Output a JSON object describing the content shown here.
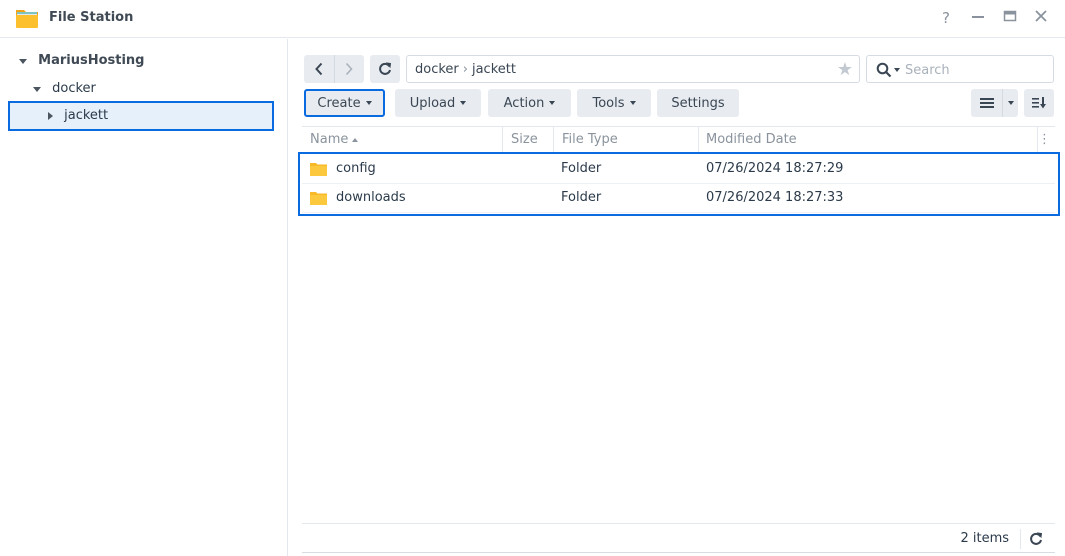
{
  "window": {
    "title": "File Station",
    "controls": {
      "help": "?",
      "minimize": "—",
      "maximize": "▭",
      "close": "✕"
    }
  },
  "tree": {
    "root": "MariusHosting",
    "children": [
      {
        "label": "docker",
        "expanded": true
      },
      {
        "label": "jackett",
        "expanded": false,
        "selected": true
      }
    ]
  },
  "navigation": {
    "path": [
      "docker",
      "jackett"
    ],
    "path_separator": "›",
    "search_placeholder": "Search"
  },
  "toolbar": {
    "create_label": "Create",
    "upload_label": "Upload",
    "action_label": "Action",
    "tools_label": "Tools",
    "settings_label": "Settings"
  },
  "grid": {
    "columns": [
      "Name",
      "Size",
      "File Type",
      "Modified Date"
    ],
    "sort_column": "Name",
    "sort_direction": "ascending",
    "rows": [
      {
        "name": "config",
        "size": "",
        "type": "Folder",
        "modified": "07/26/2024 18:27:29"
      },
      {
        "name": "downloads",
        "size": "",
        "type": "Folder",
        "modified": "07/26/2024 18:27:33"
      }
    ]
  },
  "status": {
    "item_count": "2 items"
  },
  "colors": {
    "accent": "#0a6ae0",
    "selection_bg": "#e6f0fb",
    "folder": "#fcc438",
    "button_bg": "#e8ecf1"
  }
}
